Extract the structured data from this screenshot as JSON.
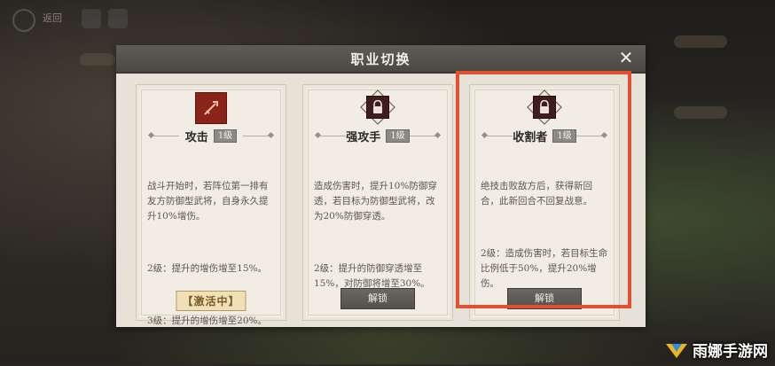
{
  "topbar": {
    "back_label": "返回"
  },
  "dialog": {
    "title": "职业切换",
    "close_symbol": "✕"
  },
  "cards": [
    {
      "name": "攻击",
      "level": "1级",
      "icon": "attack-icon",
      "desc": [
        "战斗开始时，若阵位第一排有友方防御型武将，自身永久提升10%增伤。",
        "2级：提升的增伤增至15%。",
        "3级：提升的增伤增至20%。"
      ],
      "status": "【激活中】"
    },
    {
      "name": "强攻手",
      "level": "1级",
      "icon": "lock-icon",
      "desc": [
        "造成伤害时，提升10%防御穿透，若目标为防御型武将，改为20%防御穿透。",
        "2级：提升的防御穿透增至15%，对防御将增至30%。"
      ],
      "button": "解锁"
    },
    {
      "name": "收割者",
      "level": "1级",
      "icon": "lock-icon",
      "desc": [
        "绝技击败敌方后，获得新回合，此新回合不回复战意。",
        "2级：造成伤害时，若目标生命比例低于50%，提升20%增伤。"
      ],
      "button": "解锁"
    }
  ],
  "watermark": {
    "text": "雨娜手游网"
  },
  "colors": {
    "highlight": "#e2502f",
    "titlebar": "#55524d",
    "attack_emblem": "#8a2418"
  }
}
